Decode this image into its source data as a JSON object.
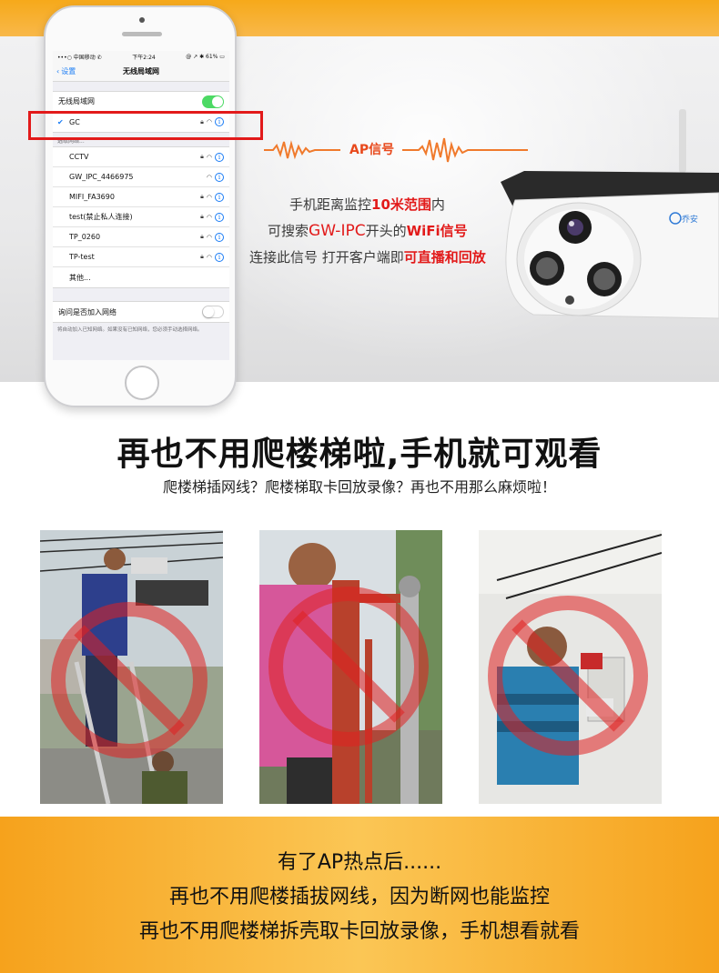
{
  "phone": {
    "status": {
      "carrier": "•••○ 中国移动 ✆",
      "time": "下午2:24",
      "battery": "@ ↗ ✱ 61% ▭"
    },
    "nav": {
      "back": "设置",
      "title": "无线局域网"
    },
    "wifi_toggle_label": "无线局域网",
    "connected_network": "GC",
    "choose_header": "选取网络...",
    "networks": [
      "CCTV",
      "GW_IPC_4466975",
      "MIFI_FA3690",
      "test(禁止私人连接)",
      "TP_0260",
      "TP-test",
      "其他..."
    ],
    "ask_join_label": "询问是否加入网络",
    "ask_join_note": "将自动加入已知网络。如果没有已知网络，您必须手动选择网络。"
  },
  "hero": {
    "ap_signal": "AP信号",
    "line1_a": "手机距离监控",
    "line1_b": "10米范围",
    "line1_c": "内",
    "line2_a": "可搜索",
    "line2_b": "GW-IPC",
    "line2_c": "开头的",
    "line2_d": "WiFi信号",
    "line3_a": "连接此信号 打开客户端即",
    "line3_b": "可直播和回放",
    "camera_brand": "乔安"
  },
  "headline": "再也不用爬楼梯啦,手机就可观看",
  "subhead": "爬楼梯插网线？爬楼梯取卡回放录像？再也不用那么麻烦啦！",
  "bottom": {
    "line1": "有了AP热点后......",
    "line2": "再也不用爬楼插拔网线，因为断网也能监控",
    "line3": "再也不用爬楼梯拆壳取卡回放录像，手机想看就看"
  },
  "colors": {
    "accent_orange": "#f6a91a",
    "highlight_red": "#e21a1a",
    "ios_blue": "#1a7cf5",
    "toggle_green": "#4cd964"
  }
}
